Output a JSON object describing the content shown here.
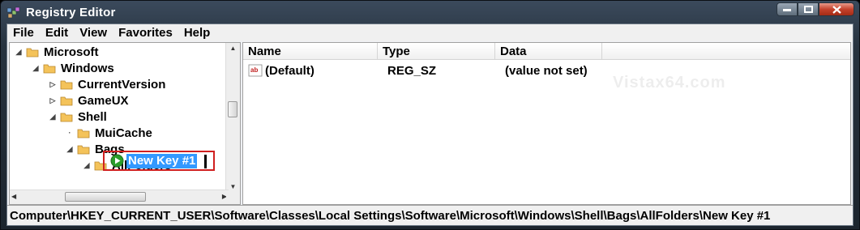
{
  "window": {
    "title": "Registry Editor"
  },
  "menu": [
    "File",
    "Edit",
    "View",
    "Favorites",
    "Help"
  ],
  "tree": [
    {
      "label": "Microsoft",
      "level": 0,
      "state": "expanded"
    },
    {
      "label": "Windows",
      "level": 1,
      "state": "expanded"
    },
    {
      "label": "CurrentVersion",
      "level": 2,
      "state": "collapsed"
    },
    {
      "label": "GameUX",
      "level": 2,
      "state": "collapsed"
    },
    {
      "label": "Shell",
      "level": 2,
      "state": "expanded"
    },
    {
      "label": "MuiCache",
      "level": 3,
      "state": "leaf"
    },
    {
      "label": "Bags",
      "level": 3,
      "state": "expanded"
    },
    {
      "label": "AllFolders",
      "level": 4,
      "state": "expanded"
    }
  ],
  "rename": {
    "value": "New Key #1"
  },
  "list": {
    "columns": [
      "Name",
      "Type",
      "Data"
    ],
    "rows": [
      {
        "name": "(Default)",
        "type": "REG_SZ",
        "data": "(value not set)",
        "icon": "string-value-icon"
      }
    ]
  },
  "status": {
    "path": "Computer\\HKEY_CURRENT_USER\\Software\\Classes\\Local Settings\\Software\\Microsoft\\Windows\\Shell\\Bags\\AllFolders\\New Key #1"
  },
  "watermark": "Vistax64.com",
  "colors": {
    "selection": "#3399ff",
    "highlight_box": "#d02020",
    "folder": "#f4c35a"
  }
}
